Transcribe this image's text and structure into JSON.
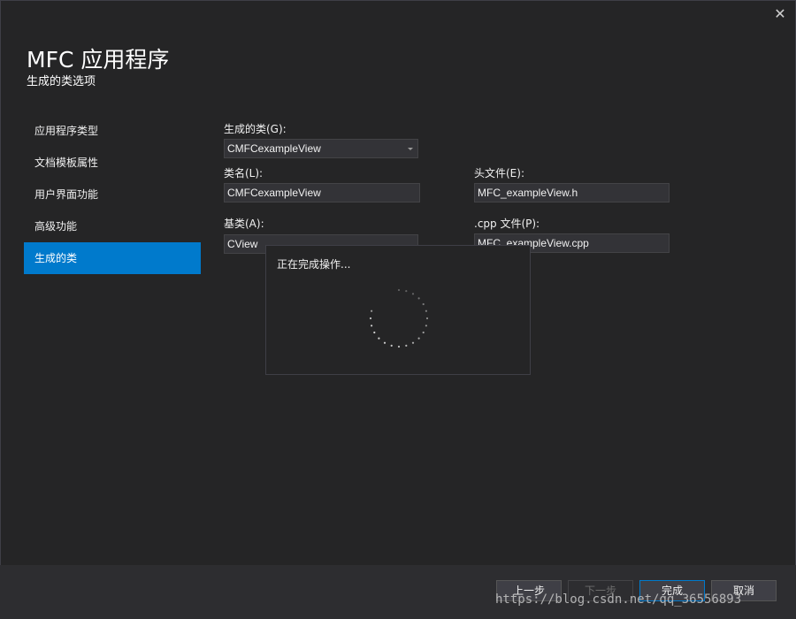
{
  "window": {
    "title": "MFC 应用程序",
    "subtitle": "生成的类选项",
    "close_icon": "close-icon",
    "close_glyph": "✕"
  },
  "sidebar": {
    "items": [
      {
        "label": "应用程序类型"
      },
      {
        "label": "文档模板属性"
      },
      {
        "label": "用户界面功能"
      },
      {
        "label": "高级功能"
      },
      {
        "label": "生成的类",
        "active": true
      }
    ]
  },
  "form": {
    "generated_class": {
      "label": "生成的类(G):",
      "value": "CMFCexampleView"
    },
    "class_name": {
      "label": "类名(L):",
      "value": "CMFCexampleView"
    },
    "header_file": {
      "label": "头文件(E):",
      "value": "MFC_exampleView.h"
    },
    "base_class": {
      "label": "基类(A):",
      "value": "CView"
    },
    "cpp_file": {
      "label": ".cpp 文件(P):",
      "value": "MFC_exampleView.cpp"
    }
  },
  "progress": {
    "message": "正在完成操作..."
  },
  "footer": {
    "prev": "上一步",
    "next": "下一步",
    "finish": "完成",
    "cancel": "取消"
  },
  "watermark": "https://blog.csdn.net/qq_36556893",
  "colors": {
    "background": "#252526",
    "accent": "#007acc",
    "footer": "#2d2d30"
  }
}
